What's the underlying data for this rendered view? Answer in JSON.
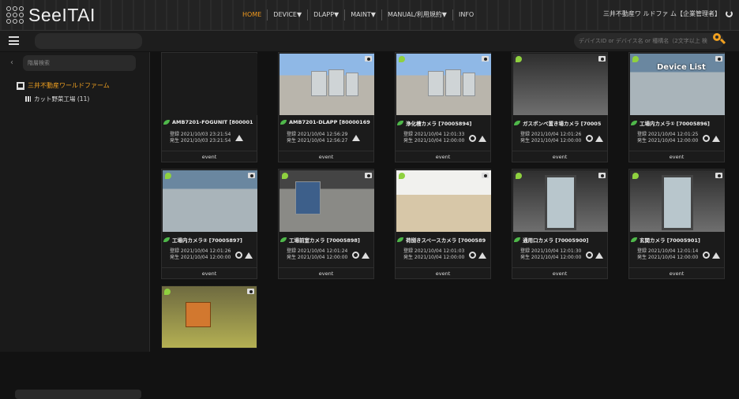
{
  "app": {
    "logo_text": "SeeITAI"
  },
  "nav": {
    "items": [
      {
        "label": "HOME",
        "active": true
      },
      {
        "label": "DEVICE▼",
        "active": false
      },
      {
        "label": "DLAPP▼",
        "active": false
      },
      {
        "label": "MAINT▼",
        "active": false
      },
      {
        "label": "MANUAL/利用規約▼",
        "active": false
      },
      {
        "label": "INFO",
        "active": false
      }
    ]
  },
  "user": {
    "label": "三井不動産ワ ルドファ ム【企業管理者】"
  },
  "search": {
    "placeholder": "デバイスID or デバイス名 or 種構名（2文字以上 検"
  },
  "sidebar": {
    "search_placeholder": "階層検索",
    "tree_root": "三井不動産ワールドファーム",
    "tree_child": "カット野菜工場 (11)"
  },
  "cards": [
    {
      "name": "AMB7201-FOGUNIT [800001",
      "registered": "登録 2021/10/03 23:21:54",
      "occurred": "発生 2021/10/03 23:21:54",
      "event": "event",
      "scene": "none",
      "dot": false
    },
    {
      "name": "AMB7201-DLAPP [80000169",
      "registered": "登録 2021/10/04 12:56:29",
      "occurred": "発生 2021/10/04 12:56:27",
      "event": "event",
      "scene": "sky",
      "dot": false
    },
    {
      "name": "浄化槽カメラ [70005894]",
      "registered": "登録 2021/10/04 12:01:33",
      "occurred": "発生 2021/10/04 12:00:00",
      "event": "event",
      "scene": "sky",
      "dot": true
    },
    {
      "name": "ガスボンベ置き場カメラ [70005",
      "registered": "登録 2021/10/04 12:01:26",
      "occurred": "発生 2021/10/04 12:00:00",
      "event": "event",
      "scene": "dim",
      "dot": true
    },
    {
      "name": "工場内カメラ① [70005896]",
      "registered": "登録 2021/10/04 12:01:25",
      "occurred": "発生 2021/10/04 12:00:00",
      "event": "event",
      "scene": "ware",
      "dot": true,
      "overlay": "Device List"
    },
    {
      "name": "工場内カメラ② [70005897]",
      "registered": "登録 2021/10/04 12:01:26",
      "occurred": "発生 2021/10/04 12:00:00",
      "event": "event",
      "scene": "ware",
      "dot": true
    },
    {
      "name": "工場前室カメラ [70005898]",
      "registered": "登録 2021/10/04 12:01:24",
      "occurred": "発生 2021/10/04 12:00:00",
      "event": "event",
      "scene": "room",
      "dot": true
    },
    {
      "name": "荷捌きスペースカメラ [7000589",
      "registered": "登録 2021/10/04 12:01:03",
      "occurred": "発生 2021/10/04 12:00:00",
      "event": "event",
      "scene": "blue",
      "dot": true
    },
    {
      "name": "通用口カメラ [70005900]",
      "registered": "登録 2021/10/04 12:01:30",
      "occurred": "発生 2021/10/04 12:00:00",
      "event": "event",
      "scene": "door",
      "dot": true
    },
    {
      "name": "玄関カメラ [70005901]",
      "registered": "登録 2021/10/04 12:01:14",
      "occurred": "発生 2021/10/04 12:00:00",
      "event": "event",
      "scene": "door",
      "dot": true
    },
    {
      "name": "",
      "registered": "",
      "occurred": "",
      "event": "",
      "scene": "yellow",
      "dot": true
    }
  ],
  "colors": {
    "accent": "#f29a1e",
    "status_green": "#8fd13f"
  }
}
